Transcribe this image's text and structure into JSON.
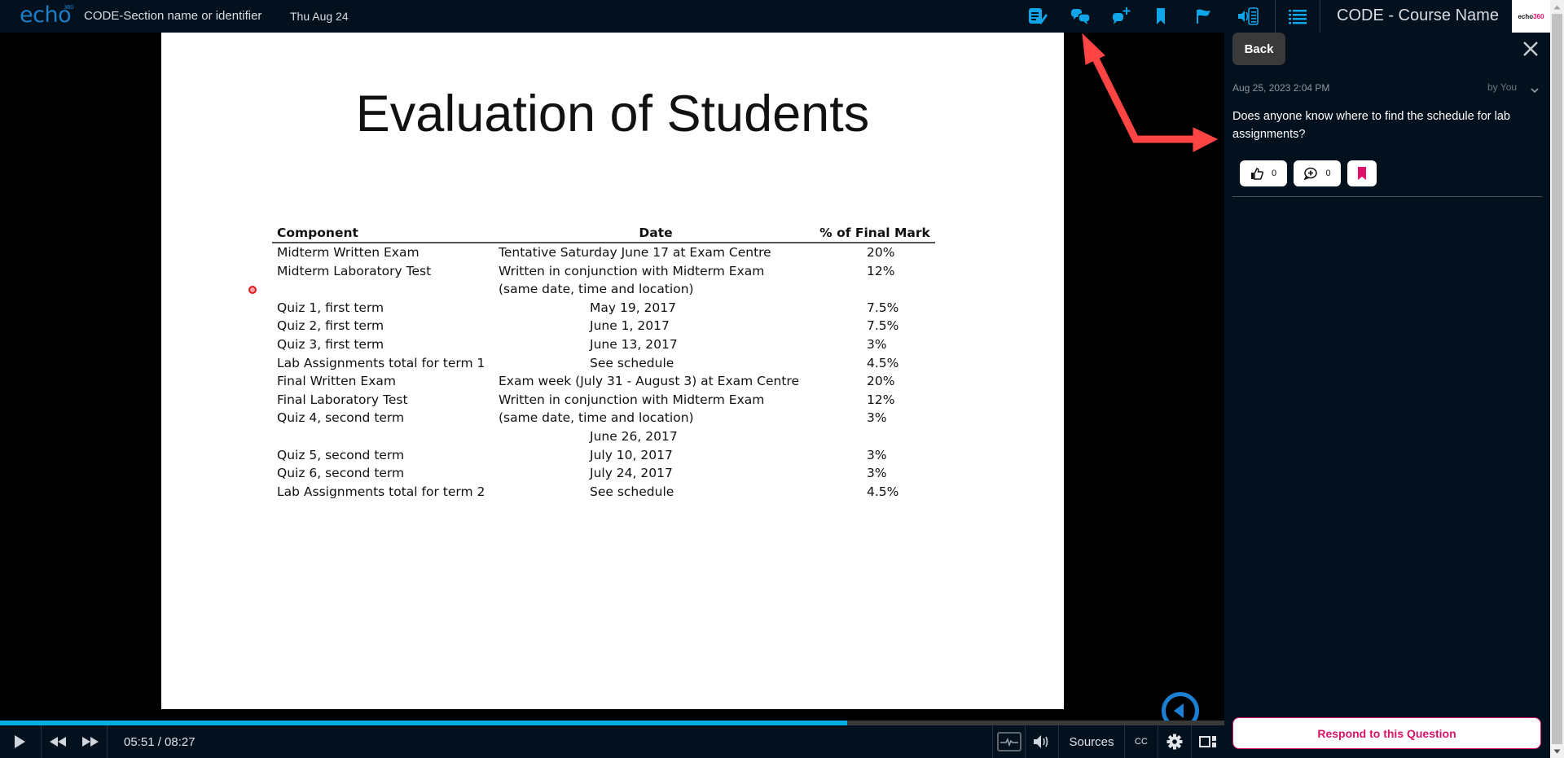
{
  "header": {
    "logo_text": "echo",
    "logo_sup": "360",
    "section": "CODE-Section name or identifier",
    "date": "Thu Aug 24",
    "course_name": "CODE - Course Name",
    "brand_text": "echo",
    "brand_text_accent": "360",
    "icons": [
      "notes-icon",
      "discussions-icon",
      "ask-question-icon",
      "bookmarks-icon",
      "flag-icon",
      "transcript-icon",
      "outline-list-icon"
    ],
    "accent_color": "#0ea5e9"
  },
  "slide": {
    "title": "Evaluation of Students",
    "columns": [
      "Component",
      "Date",
      "% of Final Mark"
    ],
    "rows": [
      {
        "component": "Midterm Written Exam",
        "date": "Tentative Saturday June 17 at Exam Centre",
        "pct": "20%",
        "align": "left"
      },
      {
        "component": "Midterm Laboratory Test",
        "date": "Written in conjunction with Midterm Exam",
        "pct": "12%",
        "align": "left"
      },
      {
        "component": "",
        "date": "(same date, time and location)",
        "pct": "",
        "align": "left"
      },
      {
        "component": "Quiz 1, first term",
        "date": "May 19, 2017",
        "pct": "7.5%",
        "align": "center"
      },
      {
        "component": "Quiz 2, first term",
        "date": "June 1, 2017",
        "pct": "7.5%",
        "align": "center"
      },
      {
        "component": "Quiz 3, first term",
        "date": "June 13, 2017",
        "pct": "3%",
        "align": "center"
      },
      {
        "component": "Lab Assignments total for term 1",
        "date": "See schedule",
        "pct": "4.5%",
        "align": "center"
      },
      {
        "component": "Final Written Exam",
        "date": "Exam week (July 31 - August 3) at Exam Centre",
        "pct": "20%",
        "align": "left"
      },
      {
        "component": "Final Laboratory Test",
        "date": "Written in conjunction with Midterm Exam",
        "pct": "12%",
        "align": "left"
      },
      {
        "component": "Quiz 4, second term",
        "date": "(same date, time and location)",
        "pct": "3%",
        "align": "left"
      },
      {
        "component": "",
        "date": "June 26, 2017",
        "pct": "",
        "align": "center"
      },
      {
        "component": "Quiz 5, second term",
        "date": "July 10, 2017",
        "pct": "3%",
        "align": "center"
      },
      {
        "component": "Quiz 6, second term",
        "date": "July 24, 2017",
        "pct": "3%",
        "align": "center"
      },
      {
        "component": "Lab Assignments total for term 2",
        "date": "See schedule",
        "pct": "4.5%",
        "align": "center"
      }
    ]
  },
  "player": {
    "current_time": "05:51",
    "duration": "08:27",
    "time_display": "05:51 / 08:27",
    "progress_fraction": 0.692,
    "sources_label": "Sources",
    "cc_label": "CC"
  },
  "panel": {
    "back_label": "Back",
    "question": {
      "timestamp": "Aug 25, 2023 2:04 PM",
      "author": "by You",
      "text": "Does anyone know where to find the schedule for lab assignments?",
      "likes": "0",
      "replies": "0"
    },
    "respond_label": "Respond to this Question",
    "respond_color": "#d8126a"
  },
  "annotation": {
    "arrow_color": "#ff4444"
  }
}
